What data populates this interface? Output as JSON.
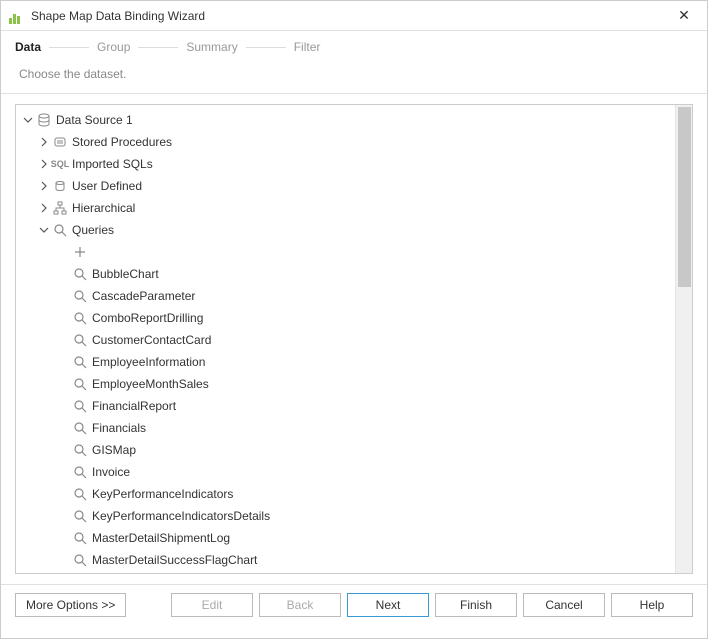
{
  "window": {
    "title": "Shape Map Data Binding Wizard"
  },
  "steps": {
    "data": "Data",
    "group": "Group",
    "summary": "Summary",
    "filter": "Filter"
  },
  "subtitle": "Choose the dataset.",
  "tree": {
    "root": "Data Source 1",
    "folders": {
      "stored_procedures": "Stored Procedures",
      "imported_sqls": "Imported SQLs",
      "user_defined": "User Defined",
      "hierarchical": "Hierarchical",
      "queries": "Queries"
    },
    "new_query": "<New Query...>",
    "queries": [
      "BubbleChart",
      "CascadeParameter",
      "ComboReportDrilling",
      "CustomerContactCard",
      "EmployeeInformation",
      "EmployeeMonthSales",
      "FinancialReport",
      "Financials",
      "GISMap",
      "Invoice",
      "KeyPerformanceIndicators",
      "KeyPerformanceIndicatorsDetails",
      "MasterDetailShipmentLog",
      "MasterDetailSuccessFlagChart"
    ]
  },
  "buttons": {
    "more": "More Options >>",
    "edit": "Edit",
    "back": "Back",
    "next": "Next",
    "finish": "Finish",
    "cancel": "Cancel",
    "help": "Help"
  }
}
